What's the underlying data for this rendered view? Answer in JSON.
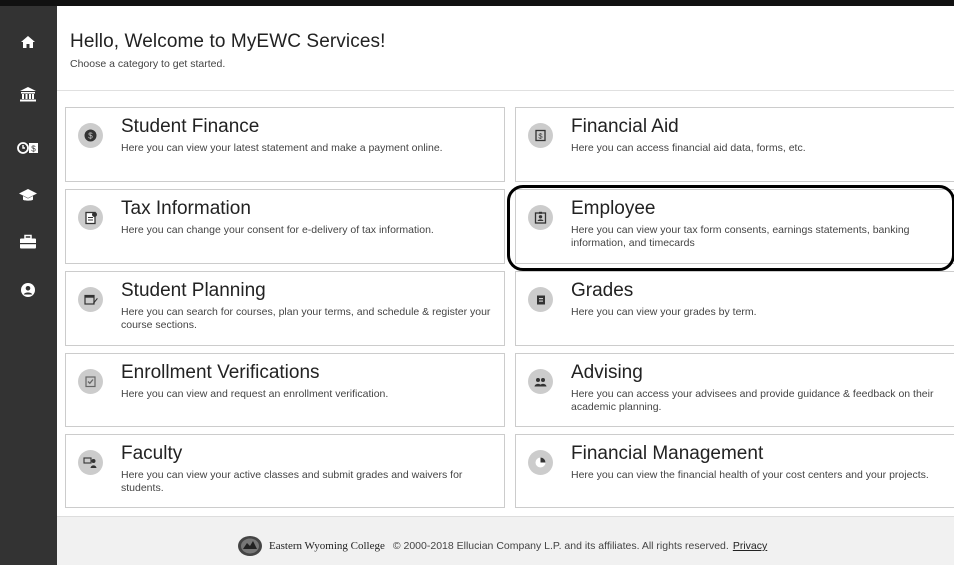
{
  "welcome": {
    "title": "Hello, Welcome to MyEWC Services!",
    "subtitle": "Choose a category to get started."
  },
  "sidebar": {
    "icons": [
      "home-icon",
      "bank-icon",
      "clock-dollar-icon",
      "graduation-cap-icon",
      "briefcase-icon",
      "user-circle-icon"
    ]
  },
  "cards": [
    {
      "title": "Student Finance",
      "desc": "Here you can view your latest statement and make a payment online.",
      "icon": "dollar-coin-icon"
    },
    {
      "title": "Financial Aid",
      "desc": "Here you can access financial aid data, forms, etc.",
      "icon": "money-bill-icon"
    },
    {
      "title": "Tax Information",
      "desc": "Here you can change your consent for e-delivery of tax information.",
      "icon": "tax-document-icon"
    },
    {
      "title": "Employee",
      "desc": "Here you can view your tax form consents, earnings statements, banking information, and timecards",
      "icon": "id-badge-icon"
    },
    {
      "title": "Student Planning",
      "desc": "Here you can search for courses, plan your terms, and schedule & register your course sections.",
      "icon": "calendar-pencil-icon"
    },
    {
      "title": "Grades",
      "desc": "Here you can view your grades by term.",
      "icon": "grade-book-icon"
    },
    {
      "title": "Enrollment Verifications",
      "desc": "Here you can view and request an enrollment verification.",
      "icon": "checklist-icon"
    },
    {
      "title": "Advising",
      "desc": "Here you can access your advisees and provide guidance & feedback on their academic planning.",
      "icon": "users-icon"
    },
    {
      "title": "Faculty",
      "desc": "Here you can view your active classes and submit grades and waivers for students.",
      "icon": "teacher-icon"
    },
    {
      "title": "Financial Management",
      "desc": "Here you can view the financial health of your cost centers and your projects.",
      "icon": "pie-chart-icon"
    }
  ],
  "footer": {
    "college": "Eastern Wyoming College",
    "copyright": "© 2000-2018 Ellucian Company L.P. and its affiliates. All rights reserved.",
    "privacy": "Privacy"
  },
  "colors": {
    "sidebar": "#333333",
    "card_border": "#cccccc",
    "icon_circle": "#cccccc",
    "footer_bg": "#f1f1f1",
    "highlight": "#000000"
  }
}
